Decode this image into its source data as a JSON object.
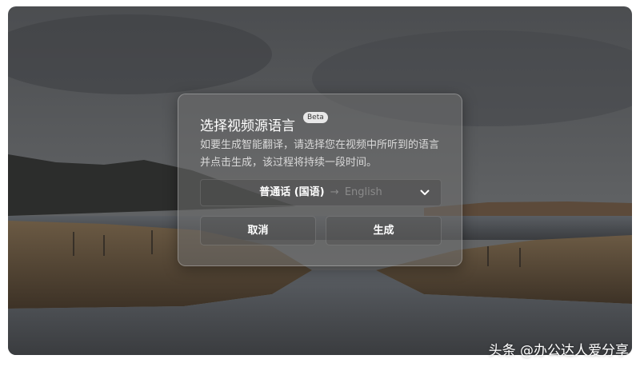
{
  "dialog": {
    "title": "选择视频源语言",
    "badge": "Beta",
    "description": "如要生成智能翻译，请选择您在视频中所听到的语言并点击生成，该过程将持续一段时间。",
    "language_select": {
      "source": "普通话 (国语)",
      "arrow": "→",
      "target": "English"
    },
    "cancel_label": "取消",
    "generate_label": "生成"
  },
  "watermark": "头条 @办公达人爱分享",
  "colors": {
    "overlay": "#6e6e6e",
    "text_primary": "#ffffff",
    "text_muted": "#8a8a8a"
  },
  "icons": {
    "dropdown": "chevron-down-icon"
  }
}
